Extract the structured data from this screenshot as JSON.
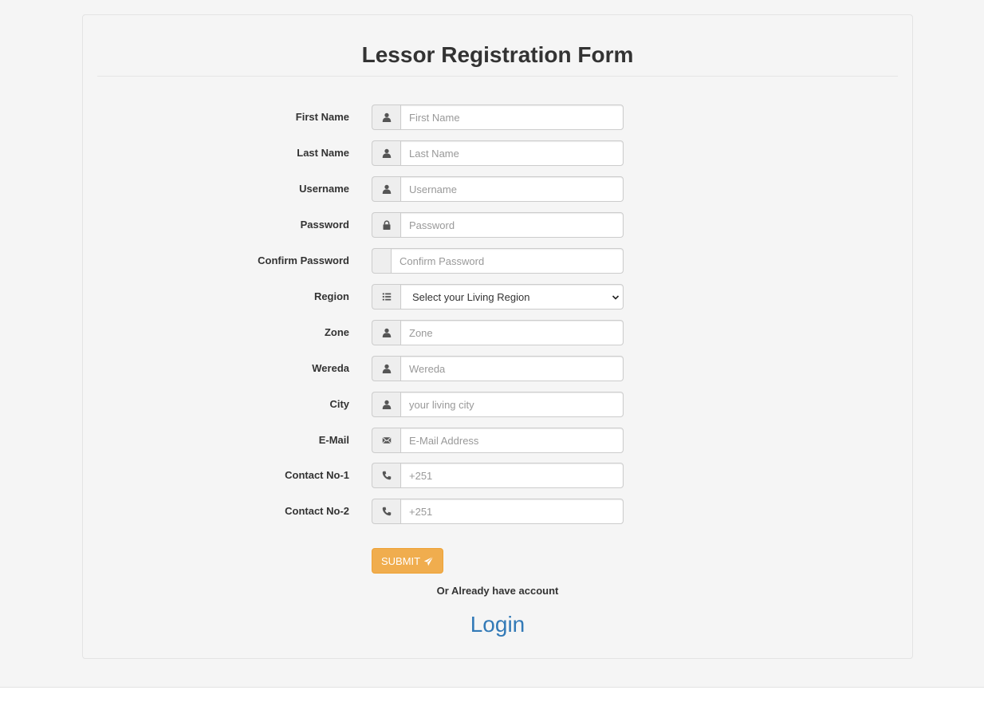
{
  "form": {
    "title": "Lessor Registration Form",
    "fields": [
      {
        "id": "first_name",
        "label": "First Name",
        "placeholder": "First Name",
        "icon": "user-icon"
      },
      {
        "id": "last_name",
        "label": "Last Name",
        "placeholder": "Last Name",
        "icon": "user-icon"
      },
      {
        "id": "username",
        "label": "Username",
        "placeholder": "Username",
        "icon": "user-icon"
      },
      {
        "id": "password",
        "label": "Password",
        "placeholder": "Password",
        "icon": "lock-icon"
      },
      {
        "id": "confirm_password",
        "label": "Confirm Password",
        "placeholder": "Confirm Password",
        "icon": "none"
      },
      {
        "id": "region",
        "label": "Region",
        "selected": "Select your Living Region",
        "icon": "list-icon"
      },
      {
        "id": "zone",
        "label": "Zone",
        "placeholder": "Zone",
        "icon": "user-icon"
      },
      {
        "id": "wereda",
        "label": "Wereda",
        "placeholder": "Wereda",
        "icon": "user-icon"
      },
      {
        "id": "city",
        "label": "City",
        "placeholder": "your living city",
        "icon": "user-icon"
      },
      {
        "id": "email",
        "label": "E-Mail",
        "placeholder": "E-Mail Address",
        "icon": "envelope-icon"
      },
      {
        "id": "contact1",
        "label": "Contact No-1",
        "placeholder": "+251",
        "icon": "phone-icon"
      },
      {
        "id": "contact2",
        "label": "Contact No-2",
        "placeholder": "+251",
        "icon": "phone-icon"
      }
    ],
    "submit_label": "SUBMIT",
    "already_text": "Or Already have account",
    "login_label": "Login"
  },
  "colors": {
    "accent_button": "#f0ad4e",
    "link": "#337ab7",
    "background": "#f5f5f5"
  }
}
